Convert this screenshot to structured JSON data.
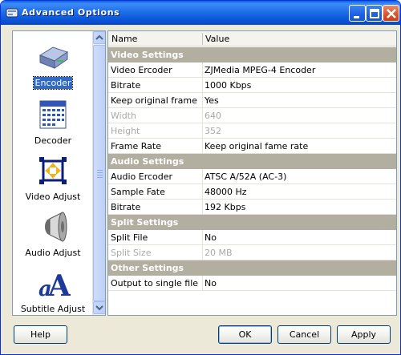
{
  "window": {
    "title": "Advanced Options"
  },
  "nav": {
    "items": [
      {
        "label": "Encoder",
        "icon": "encoder-drive-icon",
        "selected": true
      },
      {
        "label": "Decoder",
        "icon": "decoder-calendar-icon",
        "selected": false
      },
      {
        "label": "Video Adjust",
        "icon": "video-adjust-icon",
        "selected": false
      },
      {
        "label": "Audio Adjust",
        "icon": "speaker-icon",
        "selected": false
      },
      {
        "label": "Subtitle Adjust",
        "icon": "subtitle-font-icon",
        "selected": false
      }
    ]
  },
  "grid": {
    "columns": {
      "name": "Name",
      "value": "Value"
    },
    "sections": [
      {
        "title": "Video Settings",
        "rows": [
          {
            "name": "Video Ercoder",
            "value": "ZJMedia MPEG-4 Encoder",
            "disabled": false
          },
          {
            "name": "Bitrate",
            "value": "1000 Kbps",
            "disabled": false
          },
          {
            "name": "Keep original frame s...",
            "value": "Yes",
            "disabled": false
          },
          {
            "name": "Width",
            "value": "640",
            "disabled": true
          },
          {
            "name": "Height",
            "value": "352",
            "disabled": true
          },
          {
            "name": "Frame Rate",
            "value": "Keep original fame rate",
            "disabled": false
          }
        ]
      },
      {
        "title": "Audio Settings",
        "rows": [
          {
            "name": "Audio Ercoder",
            "value": "ATSC A/52A (AC-3)",
            "disabled": false
          },
          {
            "name": "Sample Fate",
            "value": "48000 Hz",
            "disabled": false
          },
          {
            "name": "Bitrate",
            "value": "192 Kbps",
            "disabled": false
          }
        ]
      },
      {
        "title": "Split Settings",
        "rows": [
          {
            "name": "Split File",
            "value": "No",
            "disabled": false
          },
          {
            "name": "Split Size",
            "value": "20 MB",
            "disabled": true
          }
        ]
      },
      {
        "title": "Other Settings",
        "rows": [
          {
            "name": "Output to single file",
            "value": "No",
            "disabled": false
          }
        ]
      }
    ]
  },
  "buttons": {
    "help": "Help",
    "ok": "OK",
    "cancel": "Cancel",
    "apply": "Apply"
  },
  "colors": {
    "titlebar": "#0a54d8",
    "selection": "#316ac5",
    "section": "#b2aea0"
  }
}
